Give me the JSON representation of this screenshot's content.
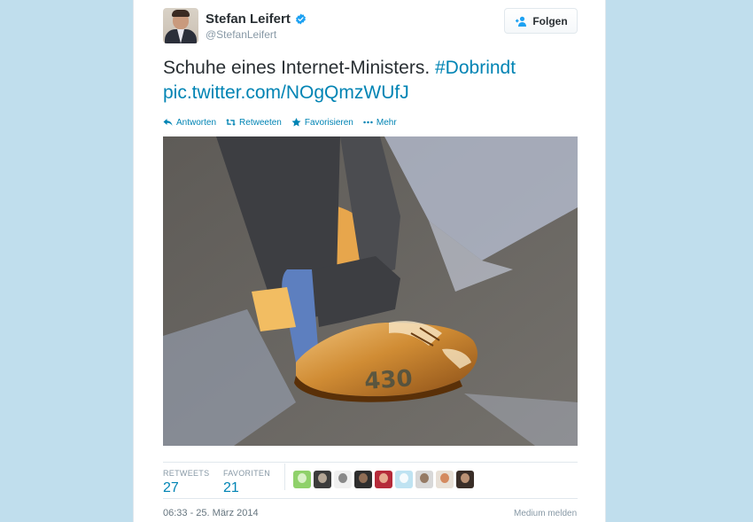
{
  "tweet": {
    "author_name": "Stefan Leifert",
    "author_handle": "@StefanLeifert",
    "follow_label": "Folgen",
    "text_main": "Schuhe eines Internet-Ministers.",
    "hashtag": "#Dobrindt",
    "pic_link": "pic.twitter.com/NOgQmzWUfJ",
    "photo_shoe_number": "430",
    "actions": [
      {
        "label": "Antworten",
        "icon": "reply-icon"
      },
      {
        "label": "Retweeten",
        "icon": "retweet-icon"
      },
      {
        "label": "Favorisieren",
        "icon": "star-icon"
      },
      {
        "label": "Mehr",
        "icon": "more-dots-icon"
      }
    ],
    "stats": {
      "retweets_label": "RETWEETS",
      "retweets_value": "27",
      "favorites_label": "FAVORITEN",
      "favorites_value": "21"
    },
    "timestamp": "06:33 - 25. März 2014",
    "report_label": "Medium melden"
  },
  "colors": {
    "background": "#c0deed",
    "link": "#0084b4",
    "text": "#292f33",
    "muted": "#8899a6",
    "verified": "#1da1f2"
  },
  "favoriters": [
    {
      "bg": "#8fd16a",
      "fg": "#e6f7d8"
    },
    {
      "bg": "#3c3c3c",
      "fg": "#c9b8a6"
    },
    {
      "bg": "#f0f0f0",
      "fg": "#777777"
    },
    {
      "bg": "#2e2e2e",
      "fg": "#a0785c"
    },
    {
      "bg": "#b52b3a",
      "fg": "#f0c2a0"
    },
    {
      "bg": "#bfe3f2",
      "fg": "#ffffff"
    },
    {
      "bg": "#d8d8d8",
      "fg": "#8a6a50"
    },
    {
      "bg": "#e8e0d6",
      "fg": "#d07a4a"
    },
    {
      "bg": "#3a2e28",
      "fg": "#d2a383"
    }
  ]
}
